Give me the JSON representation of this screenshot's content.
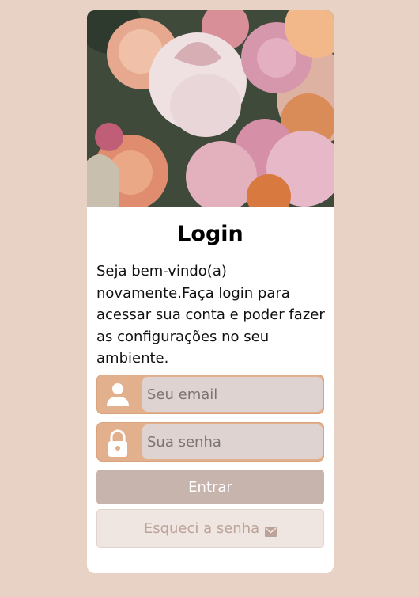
{
  "login": {
    "title": "Login",
    "description": "Seja bem-vindo(a) novamente.Faça login para acessar sua conta e poder fazer as configurações no seu ambiente.",
    "email_placeholder": "Seu email",
    "password_placeholder": "Sua senha",
    "submit_label": "Entrar",
    "forgot_label": "Esqueci a senha"
  },
  "icons": {
    "email_field": "person-icon",
    "password_field": "lock-icon",
    "forgot": "mail-icon"
  },
  "colors": {
    "page_background": "#e8d2c6",
    "field_accent": "#e3b08d",
    "input_background": "#dfd3d1",
    "primary_button": "#c7b4ad",
    "secondary_button": "#f0e6e1"
  }
}
